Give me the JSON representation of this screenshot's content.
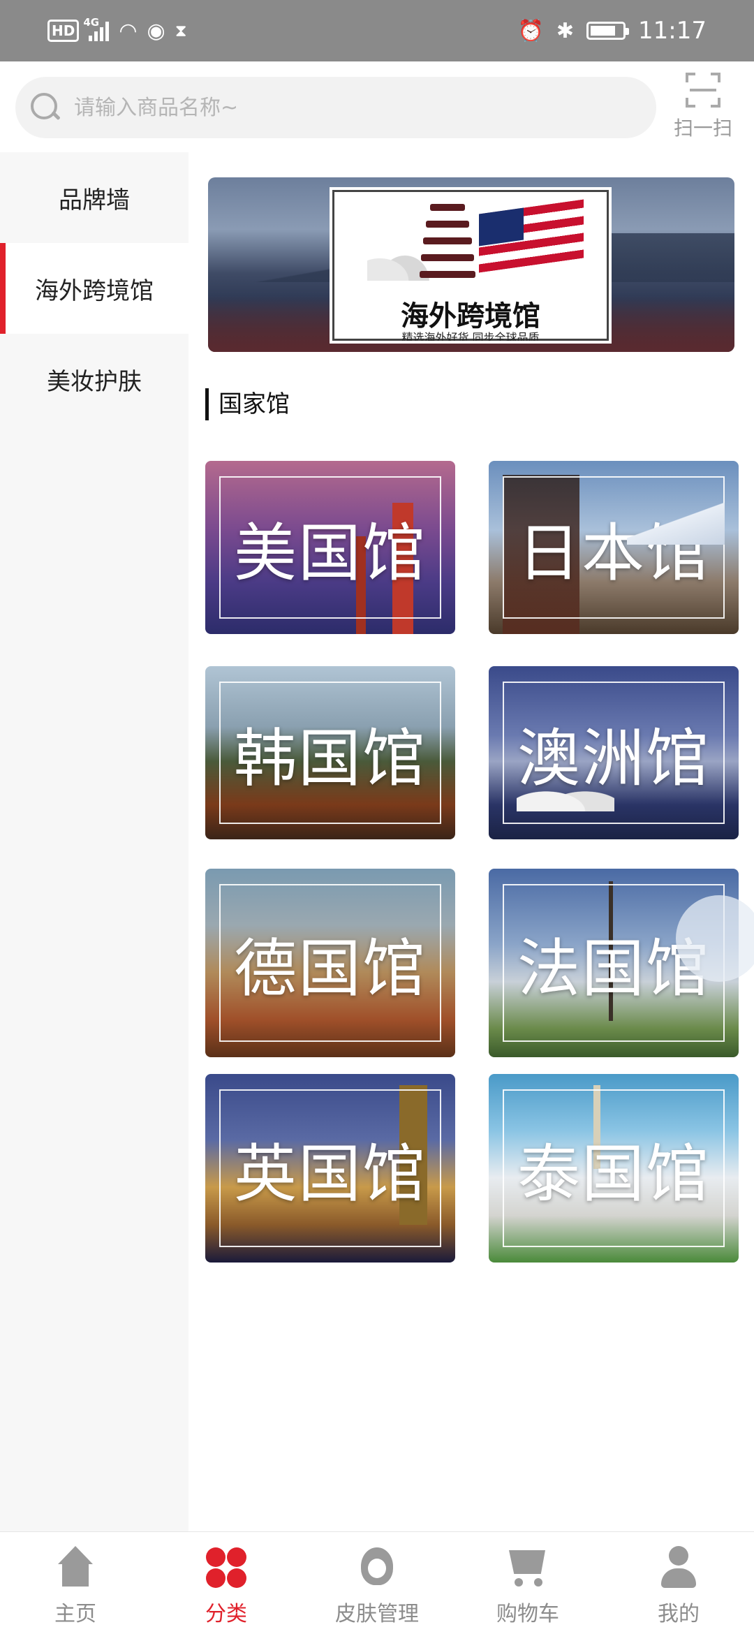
{
  "status_bar": {
    "time": "11:17",
    "network": "4G",
    "hd": "HD"
  },
  "search": {
    "placeholder": "请输入商品名称~",
    "value": "",
    "scan_label": "扫一扫"
  },
  "sidebar": {
    "items": [
      {
        "label": "品牌墙",
        "active": false
      },
      {
        "label": "海外跨境馆",
        "active": true
      },
      {
        "label": "美妆护肤",
        "active": false
      }
    ]
  },
  "banner": {
    "title": "海外跨境馆",
    "subtitle": "精选海外好货 同步全球品质"
  },
  "section": {
    "title": "国家馆"
  },
  "pavilions": [
    {
      "label": "美国馆"
    },
    {
      "label": "日本馆"
    },
    {
      "label": "韩国馆"
    },
    {
      "label": "澳洲馆"
    },
    {
      "label": "德国馆"
    },
    {
      "label": "法国馆"
    },
    {
      "label": "英国馆"
    },
    {
      "label": "泰国馆"
    }
  ],
  "tabbar": {
    "items": [
      {
        "label": "主页",
        "icon": "home-icon",
        "active": false
      },
      {
        "label": "分类",
        "icon": "category-icon",
        "active": true
      },
      {
        "label": "皮肤管理",
        "icon": "skin-icon",
        "active": false
      },
      {
        "label": "购物车",
        "icon": "cart-icon",
        "active": false
      },
      {
        "label": "我的",
        "icon": "profile-icon",
        "active": false
      }
    ]
  },
  "colors": {
    "accent": "#e0212b",
    "status_bar": "#8a8a8a",
    "sidebar_bg": "#f7f7f7"
  }
}
